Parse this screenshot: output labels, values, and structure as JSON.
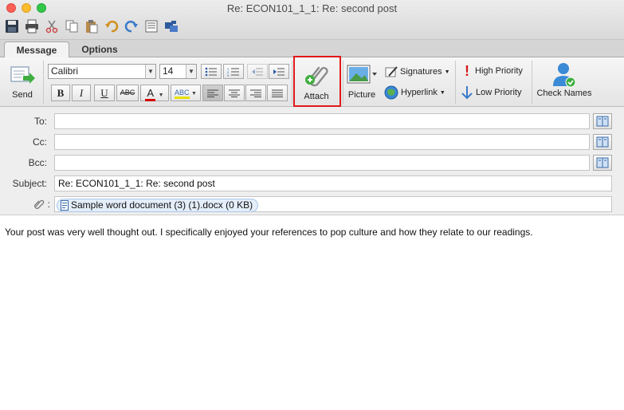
{
  "window": {
    "title": "Re: ECON101_1_1: Re: second post"
  },
  "quick_toolbar": {
    "icons": [
      "save-icon",
      "print-icon",
      "cut-icon",
      "copy-icon",
      "paste-icon",
      "undo-icon",
      "redo-icon",
      "format-icon",
      "sync-icon"
    ]
  },
  "tabs": [
    {
      "label": "Message",
      "active": true
    },
    {
      "label": "Options",
      "active": false
    }
  ],
  "ribbon": {
    "send_label": "Send",
    "font_name": "Calibri",
    "font_size": "14",
    "bold": "B",
    "italic": "I",
    "underline": "U",
    "strikethrough": "ABC",
    "font_color_glyph": "A",
    "highlight_glyph": "ABC",
    "attach_label": "Attach",
    "picture_label": "Picture",
    "signatures_label": "Signatures",
    "hyperlink_label": "Hyperlink",
    "high_priority_label": "High Priority",
    "low_priority_label": "Low Priority",
    "check_names_label": "Check Names"
  },
  "fields": {
    "to_label": "To:",
    "to_value": "",
    "cc_label": "Cc:",
    "cc_value": "",
    "bcc_label": "Bcc:",
    "bcc_value": "",
    "subject_label": "Subject:",
    "subject_value": "Re: ECON101_1_1: Re: second post",
    "attachments_label": ":",
    "attachment_name": "Sample word document (3) (1).docx (0 KB)"
  },
  "body": {
    "text": "Your post was very well thought out. I specifically enjoyed your references to pop culture and how they relate to our readings."
  },
  "colors": {
    "highlight_box": "#e0191a",
    "attachment_chip": "#e4eefa",
    "font_color_underline": "#d40000"
  }
}
